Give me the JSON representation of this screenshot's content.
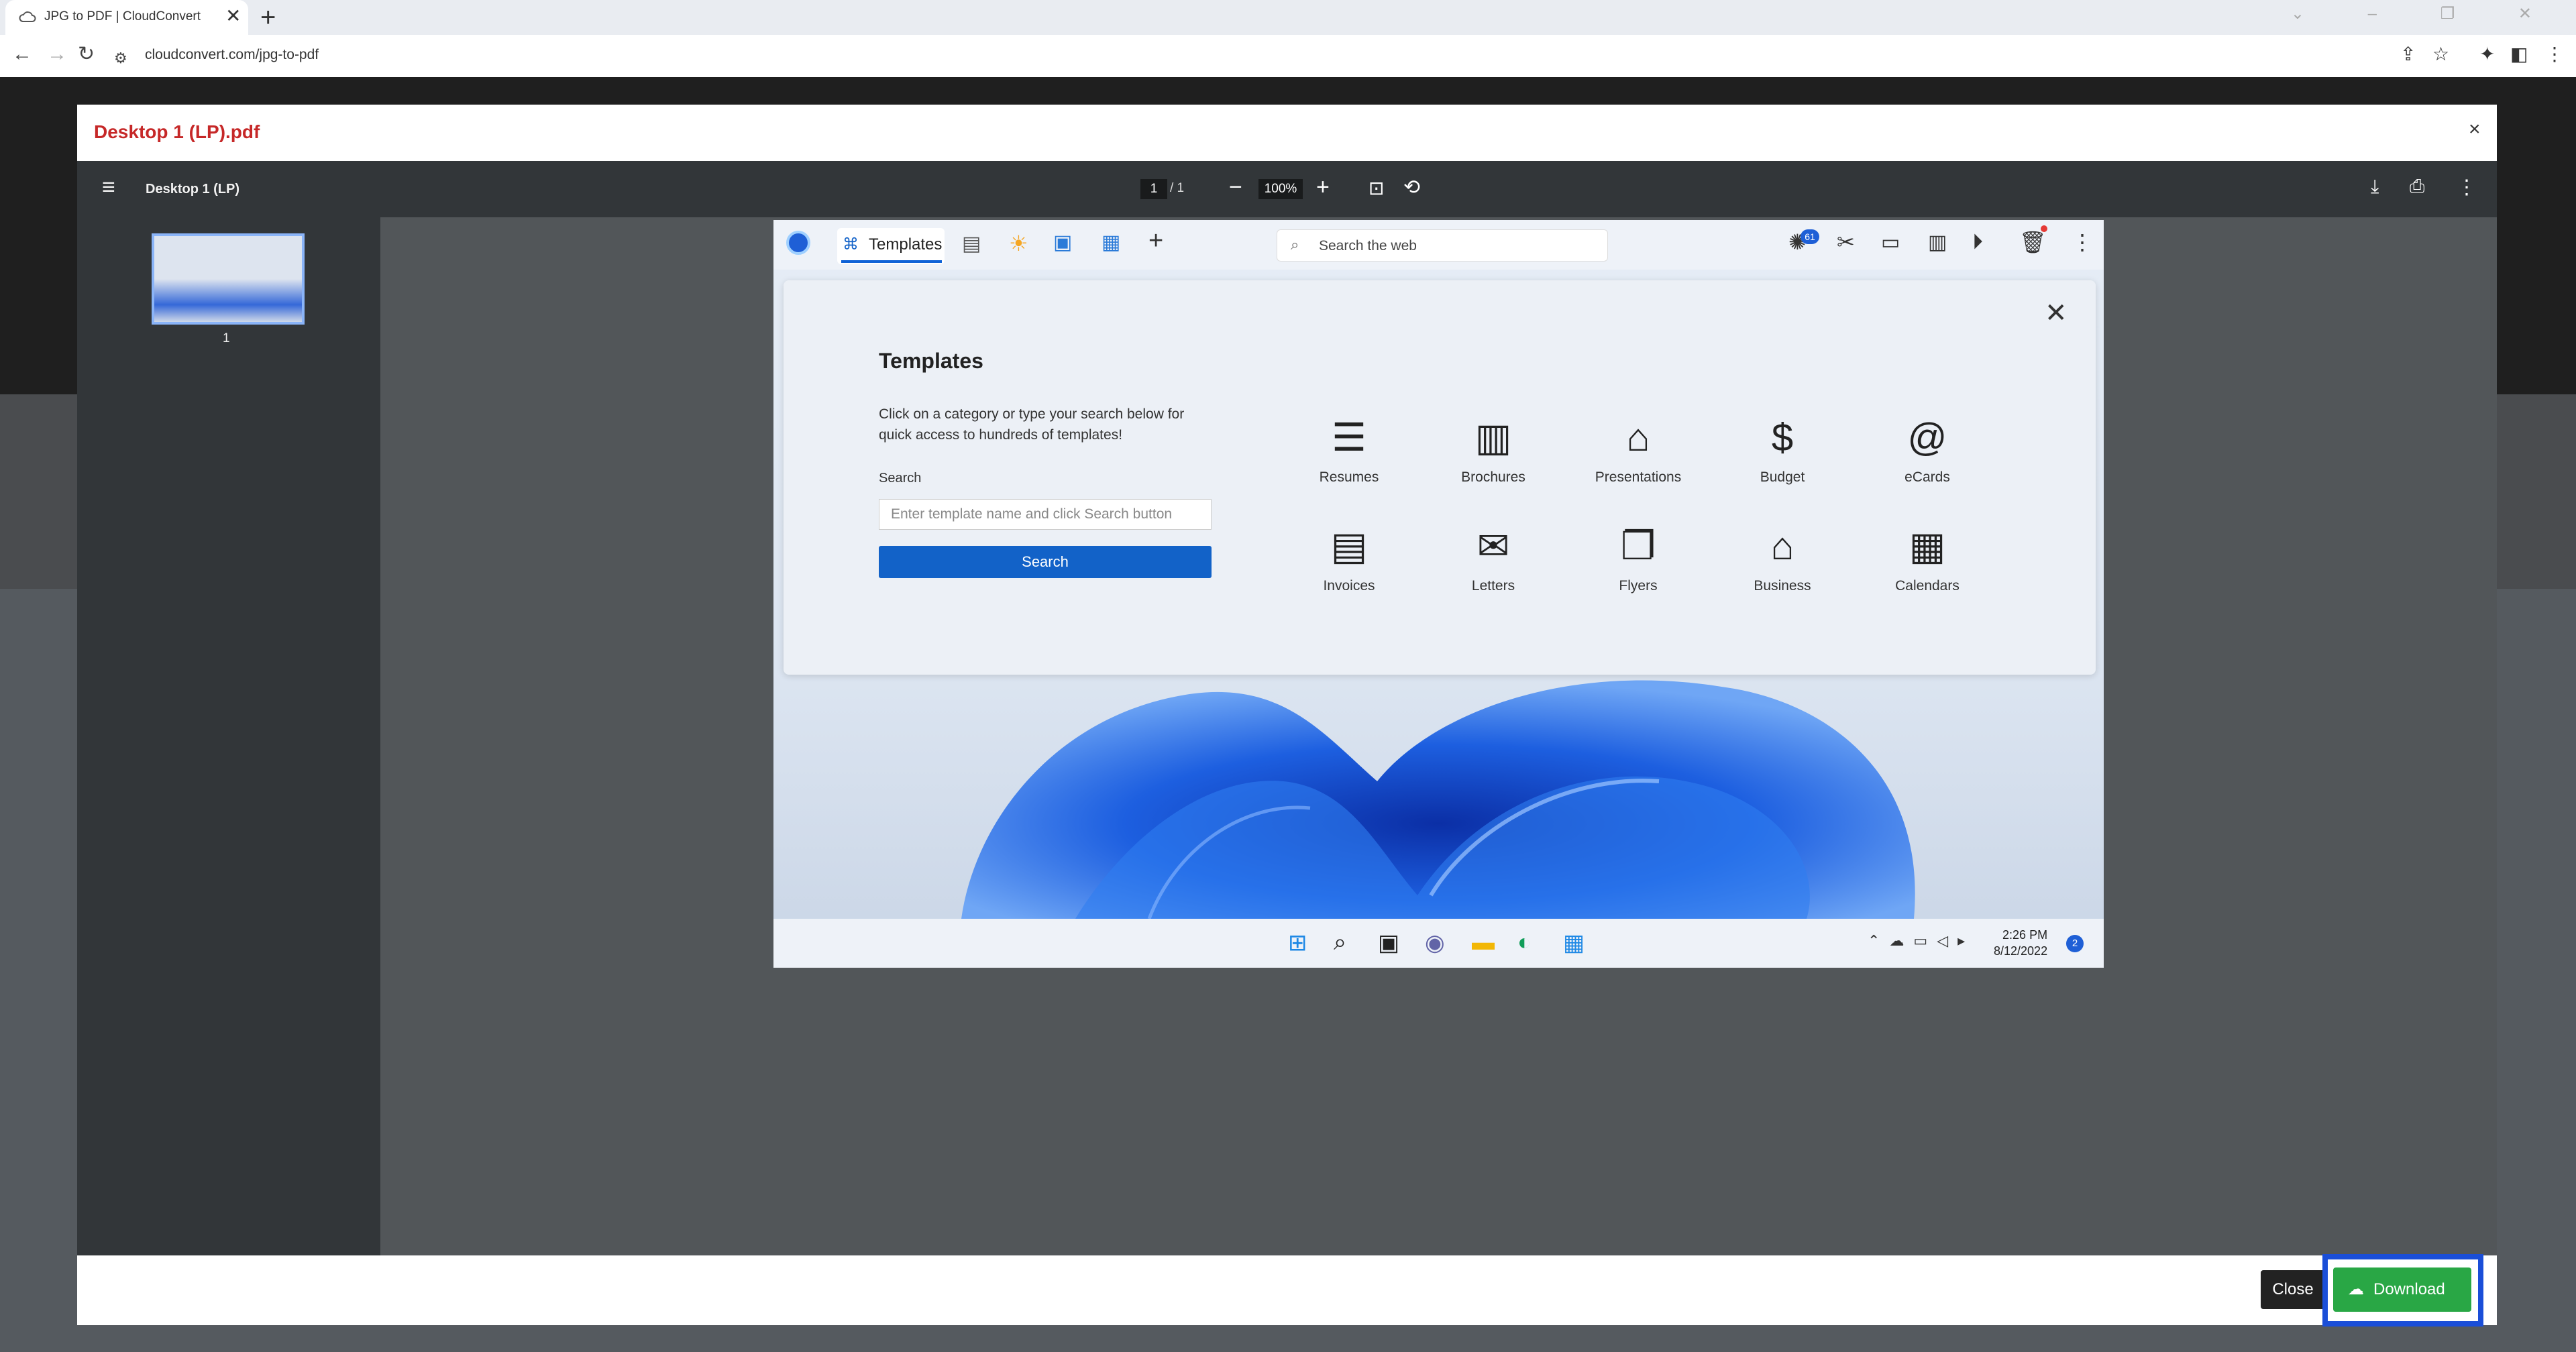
{
  "browser": {
    "tab_title": "JPG to PDF | CloudConvert",
    "tab_close": "✕",
    "new_tab": "+",
    "url": "cloudconvert.com/jpg-to-pdf",
    "window_controls": "⌄ – ❐ ✕"
  },
  "modal": {
    "title": "Desktop 1 (LP).pdf",
    "close_x": "×",
    "close_label": "Close",
    "download_label": "Download"
  },
  "pdf_viewer": {
    "file_name": "Desktop 1 (LP)",
    "page_current": "1",
    "page_total": "/  1",
    "zoom": "100%",
    "thumbnail_number": "1"
  },
  "screenshot": {
    "tab_label": "Templates",
    "web_search_placeholder": "Search the web",
    "badge_count": "61",
    "templates_title": "Templates",
    "templates_desc": "Click on a category or type your search below for quick access to hundreds of templates!",
    "search_label": "Search",
    "search_placeholder": "Enter template name and click Search button",
    "search_button": "Search",
    "categories": [
      {
        "label": "Resumes",
        "icon": "resume-icon"
      },
      {
        "label": "Brochures",
        "icon": "brochure-icon"
      },
      {
        "label": "Presentations",
        "icon": "presentation-icon"
      },
      {
        "label": "Budget",
        "icon": "budget-icon"
      },
      {
        "label": "eCards",
        "icon": "ecard-icon"
      },
      {
        "label": "Invoices",
        "icon": "invoice-icon"
      },
      {
        "label": "Letters",
        "icon": "letter-icon"
      },
      {
        "label": "Flyers",
        "icon": "flyer-icon"
      },
      {
        "label": "Business",
        "icon": "business-icon"
      },
      {
        "label": "Calendars",
        "icon": "calendar-icon"
      }
    ],
    "clock_time": "2:26 PM",
    "clock_date": "8/12/2022",
    "notification_count": "2"
  },
  "colors": {
    "accent_blue": "#1262c8",
    "download_green": "#29a745",
    "title_red": "#c62828",
    "highlight_blue": "#1a4ed8"
  }
}
